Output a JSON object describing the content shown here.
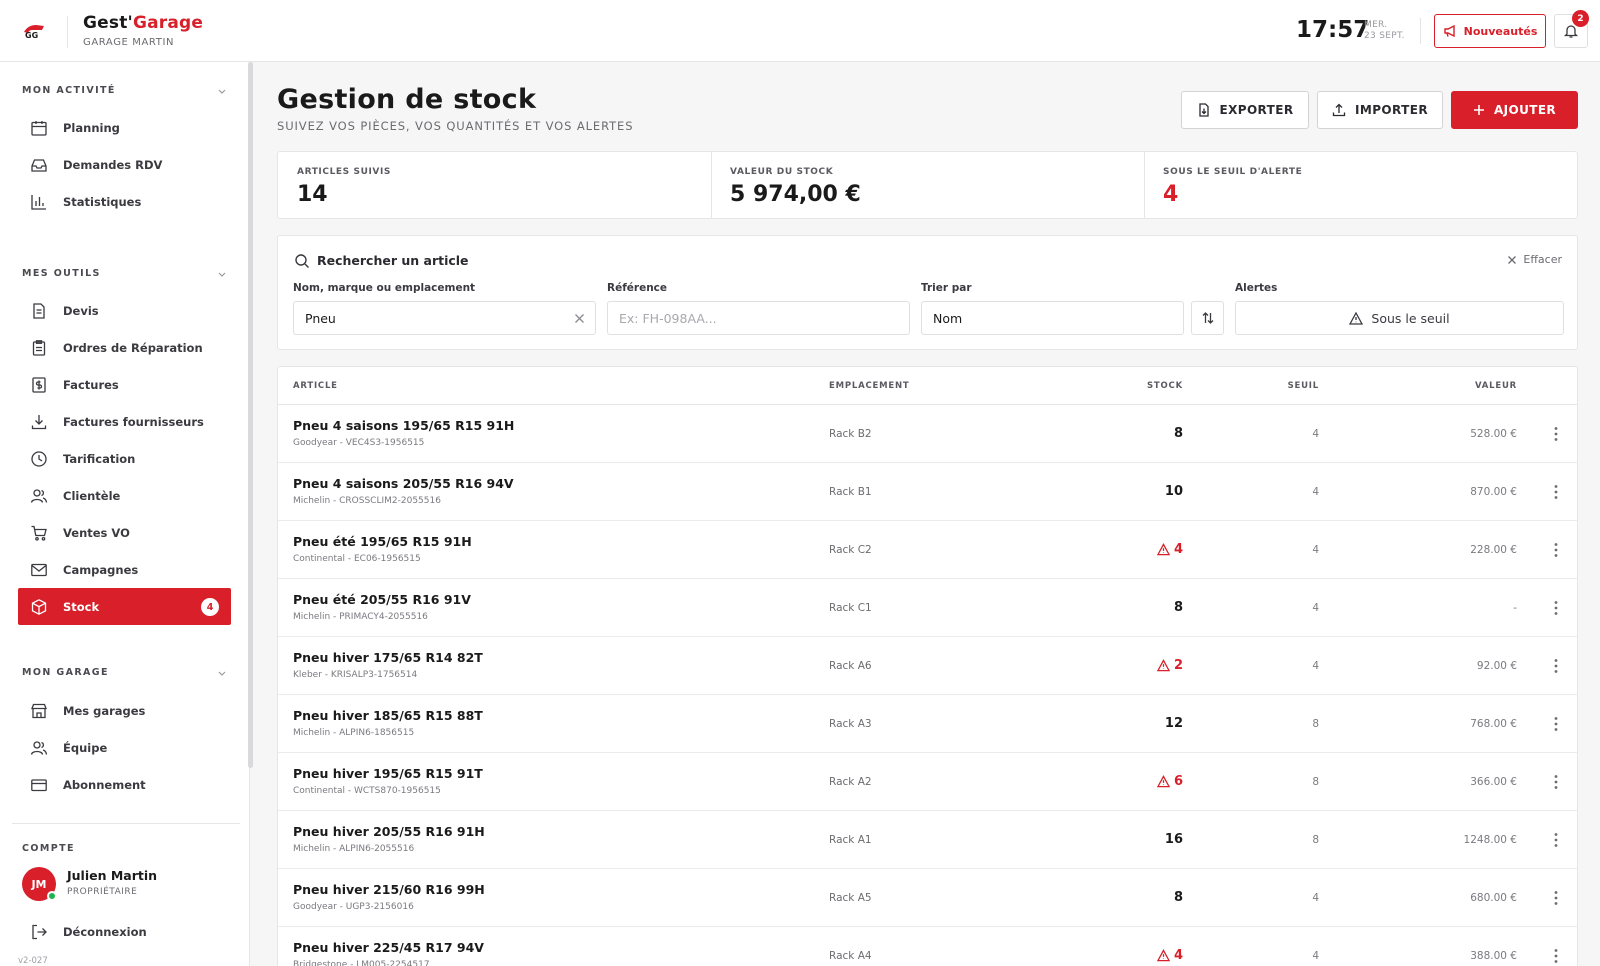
{
  "brand": {
    "name_prefix": "Gest'",
    "name_suffix": "Garage",
    "subtitle": "GARAGE MARTIN",
    "logo_text": "GG"
  },
  "header": {
    "time": "17:57",
    "day": "MER.",
    "date": "23 SEPT.",
    "news_label": "Nouveautés",
    "notification_count": "2"
  },
  "sidebar": {
    "sections": [
      {
        "title": "MON ACTIVITÉ",
        "items": [
          {
            "label": "Planning",
            "icon": "calendar-icon"
          },
          {
            "label": "Demandes RDV",
            "icon": "inbox-icon"
          },
          {
            "label": "Statistiques",
            "icon": "bar-chart-icon"
          }
        ]
      },
      {
        "title": "MES OUTILS",
        "items": [
          {
            "label": "Devis",
            "icon": "document-icon"
          },
          {
            "label": "Ordres de Réparation",
            "icon": "clipboard-icon"
          },
          {
            "label": "Factures",
            "icon": "invoice-icon"
          },
          {
            "label": "Factures fournisseurs",
            "icon": "download-icon"
          },
          {
            "label": "Tarification",
            "icon": "clock-icon"
          },
          {
            "label": "Clientèle",
            "icon": "users-icon"
          },
          {
            "label": "Ventes VO",
            "icon": "cart-icon"
          },
          {
            "label": "Campagnes",
            "icon": "mail-icon"
          },
          {
            "label": "Stock",
            "icon": "box-icon",
            "active": true,
            "badge": "4"
          }
        ]
      },
      {
        "title": "MON GARAGE",
        "items": [
          {
            "label": "Mes garages",
            "icon": "store-icon"
          },
          {
            "label": "Équipe",
            "icon": "team-icon"
          },
          {
            "label": "Abonnement",
            "icon": "credit-card-icon"
          }
        ]
      }
    ],
    "account": {
      "title": "COMPTE",
      "initials": "JM",
      "name": "Julien Martin",
      "role": "PROPRIÉTAIRE",
      "logout_label": "Déconnexion"
    },
    "version": "v2-027"
  },
  "page": {
    "title": "Gestion de stock",
    "subtitle": "SUIVEZ VOS PIÈCES, VOS QUANTITÉS ET VOS ALERTES",
    "export_label": "EXPORTER",
    "import_label": "IMPORTER",
    "add_label": "AJOUTER"
  },
  "stats": [
    {
      "label": "ARTICLES SUIVIS",
      "value": "14"
    },
    {
      "label": "VALEUR DU STOCK",
      "value": "5 974,00 €"
    },
    {
      "label": "SOUS LE SEUIL D'ALERTE",
      "value": "4"
    }
  ],
  "filters": {
    "title": "Rechercher un article",
    "clear_label": "Effacer",
    "name_label": "Nom, marque ou emplacement",
    "name_value": "Pneu",
    "ref_label": "Référence",
    "ref_placeholder": "Ex: FH-098AA...",
    "sort_label": "Trier par",
    "sort_value": "Nom",
    "alerts_label": "Alertes",
    "alerts_value": "Sous le seuil"
  },
  "table": {
    "columns": {
      "article": "ARTICLE",
      "location": "EMPLACEMENT",
      "stock": "STOCK",
      "threshold": "SEUIL",
      "value": "VALEUR"
    },
    "rows": [
      {
        "name": "Pneu 4 saisons 195/65 R15 91H",
        "ref": "Goodyear - VEC4S3-1956515",
        "location": "Rack B2",
        "stock": "8",
        "low": false,
        "threshold": "4",
        "value": "528.00 €"
      },
      {
        "name": "Pneu 4 saisons 205/55 R16 94V",
        "ref": "Michelin - CROSSCLIM2-2055516",
        "location": "Rack B1",
        "stock": "10",
        "low": false,
        "threshold": "4",
        "value": "870.00 €"
      },
      {
        "name": "Pneu été 195/65 R15 91H",
        "ref": "Continental - EC06-1956515",
        "location": "Rack C2",
        "stock": "4",
        "low": true,
        "threshold": "4",
        "value": "228.00 €"
      },
      {
        "name": "Pneu été 205/55 R16 91V",
        "ref": "Michelin - PRIMACY4-2055516",
        "location": "Rack C1",
        "stock": "8",
        "low": false,
        "threshold": "4",
        "value": "-"
      },
      {
        "name": "Pneu hiver 175/65 R14 82T",
        "ref": "Kleber - KRISALP3-1756514",
        "location": "Rack A6",
        "stock": "2",
        "low": true,
        "threshold": "4",
        "value": "92.00 €"
      },
      {
        "name": "Pneu hiver 185/65 R15 88T",
        "ref": "Michelin - ALPIN6-1856515",
        "location": "Rack A3",
        "stock": "12",
        "low": false,
        "threshold": "8",
        "value": "768.00 €"
      },
      {
        "name": "Pneu hiver 195/65 R15 91T",
        "ref": "Continental - WCTS870-1956515",
        "location": "Rack A2",
        "stock": "6",
        "low": true,
        "threshold": "8",
        "value": "366.00 €"
      },
      {
        "name": "Pneu hiver 205/55 R16 91H",
        "ref": "Michelin - ALPIN6-2055516",
        "location": "Rack A1",
        "stock": "16",
        "low": false,
        "threshold": "8",
        "value": "1248.00 €"
      },
      {
        "name": "Pneu hiver 215/60 R16 99H",
        "ref": "Goodyear - UGP3-2156016",
        "location": "Rack A5",
        "stock": "8",
        "low": false,
        "threshold": "4",
        "value": "680.00 €"
      },
      {
        "name": "Pneu hiver 225/45 R17 94V",
        "ref": "Bridgestone - LM005-2254517",
        "location": "Rack A4",
        "stock": "4",
        "low": true,
        "threshold": "4",
        "value": "388.00 €"
      }
    ]
  },
  "colors": {
    "accent": "#d81f2a",
    "online": "#1fb24b"
  }
}
